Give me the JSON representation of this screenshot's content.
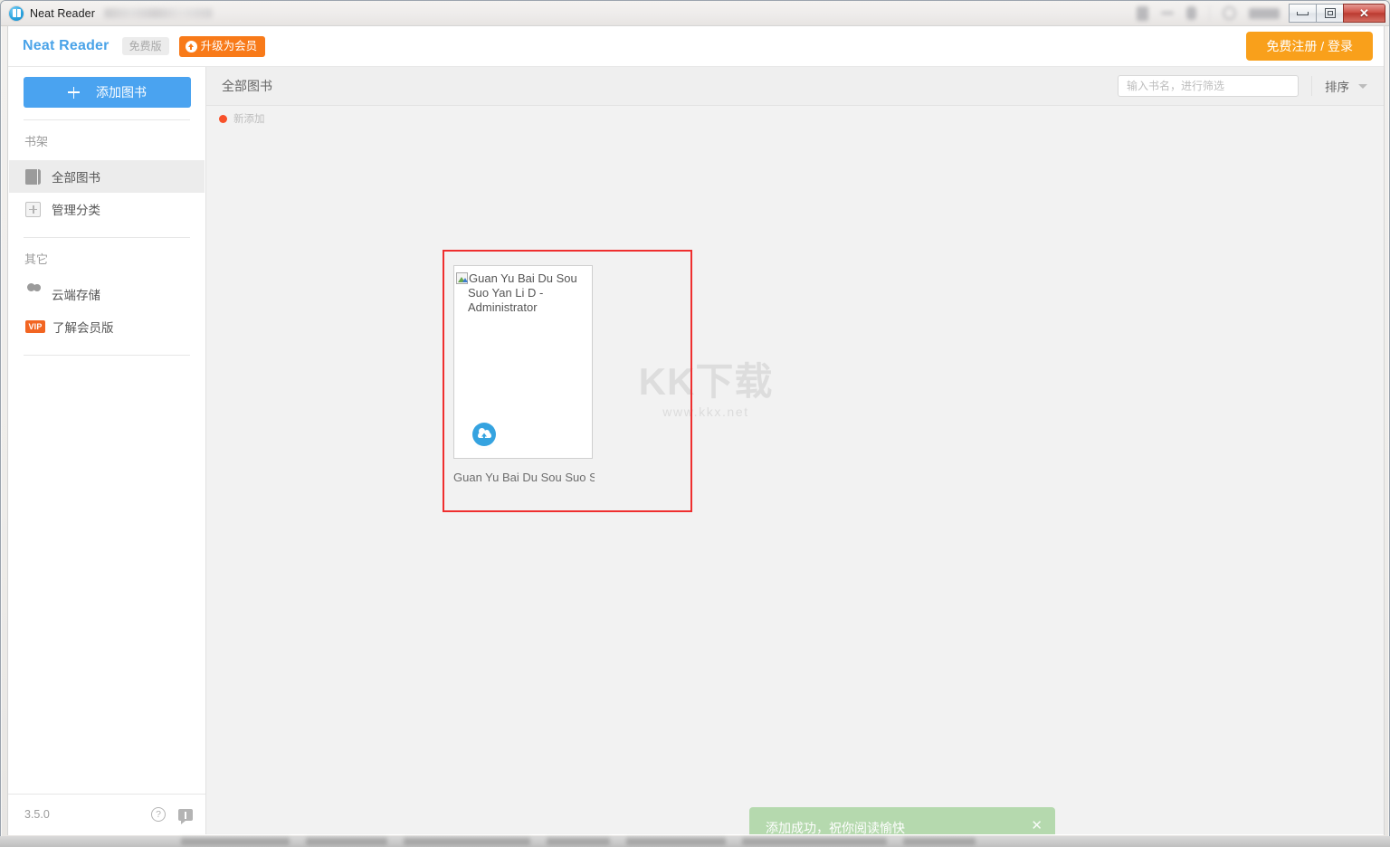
{
  "window": {
    "title": "Neat Reader",
    "app_icon": "book-circle-icon",
    "controls": {
      "minimize": "minimize-icon",
      "maximize": "restore-icon",
      "close": "✕"
    }
  },
  "appbar": {
    "brand": "Neat Reader",
    "free_badge": "免费版",
    "upgrade_badge": "升级为会员",
    "login_button": "免费注册 / 登录",
    "brand_color": "#4aa3e8",
    "upgrade_color": "#f87a19",
    "login_color": "#f9a01b"
  },
  "sidebar": {
    "add_button": "添加图书",
    "sections": [
      {
        "heading": "书架",
        "items": [
          {
            "label": "全部图书",
            "icon": "book-icon",
            "active": true
          },
          {
            "label": "管理分类",
            "icon": "plus-box-icon",
            "active": false
          }
        ]
      },
      {
        "heading": "其它",
        "items": [
          {
            "label": "云端存储",
            "icon": "cloud-icon",
            "active": false
          },
          {
            "label": "了解会员版",
            "icon": "vip-icon",
            "badge": "VIP",
            "active": false
          }
        ]
      }
    ],
    "footer": {
      "version": "3.5.0",
      "help_icon": "?",
      "feedback_icon": "feedback-icon"
    }
  },
  "main": {
    "breadcrumb": "全部图书",
    "search": {
      "value": "",
      "placeholder": "输入书名，进行筛选"
    },
    "sort": {
      "label": "排序",
      "caret": "chevron-down-icon"
    },
    "new_tag": "新添加",
    "books": [
      {
        "cover_alt": "Guan Yu Bai Du Sou Suo Yan Li D - Administrator",
        "title": "Guan Yu Bai Du Sou Suo Suo Y...",
        "cloud_state": "cloud-upload-icon"
      }
    ]
  },
  "watermark": {
    "text": "KK下载",
    "url": "www.kkx.net"
  },
  "toast": {
    "message": "添加成功，祝你阅读愉快",
    "close": "✕",
    "color": "#b5d9ae"
  },
  "annotation": {
    "highlight_color": "#ef2f2f"
  }
}
